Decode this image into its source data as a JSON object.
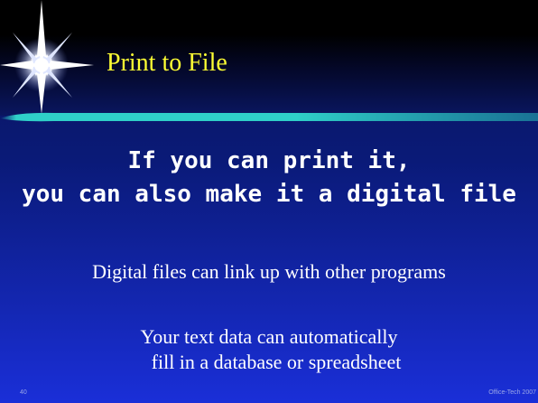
{
  "slide": {
    "title": "Print to File",
    "headline_line1": "If you can print it,",
    "headline_line2": "you can also make it a digital file",
    "body_line1": "Digital files can link up with other programs",
    "body_line2": "Your text  data can automatically",
    "body_line3": "fill in a database or spreadsheet",
    "slide_number": "40",
    "footer": "Office-Tech 2007"
  },
  "colors": {
    "title": "#ffff33",
    "text": "#ffffff",
    "background_top": "#000000",
    "background_bottom": "#1a2fd8",
    "rule_accent": "#2fd0c8"
  },
  "icons": {
    "decoration": "starburst-icon"
  }
}
